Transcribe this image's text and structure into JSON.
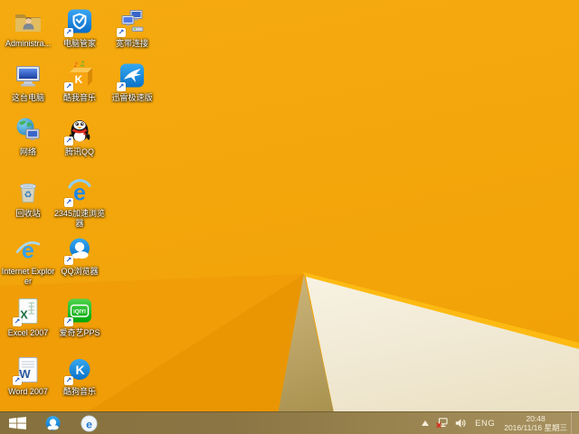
{
  "wallpaper": {
    "base_color": "#f4a70d",
    "facet_medium": "#f09d07",
    "facet_dark": "#ea9603",
    "facet_khaki": "#b89f5e",
    "facet_cream": "#f3edda",
    "edge_highlight": "#fdba12"
  },
  "desktop": {
    "icons": [
      {
        "name": "administrator-folder",
        "label": "Administra..."
      },
      {
        "name": "pc-manager",
        "label": "电脑管家"
      },
      {
        "name": "broadband-connection",
        "label": "宽带连接"
      },
      {
        "name": "this-pc",
        "label": "这台电脑"
      },
      {
        "name": "kuwo-music",
        "label": "酷我音乐"
      },
      {
        "name": "xunlei-speed",
        "label": "迅雷极速版"
      },
      {
        "name": "network",
        "label": "网络"
      },
      {
        "name": "tencent-qq",
        "label": "腾讯QQ"
      },
      {
        "name": "recycle-bin",
        "label": "回收站"
      },
      {
        "name": "browser-2345",
        "label": "2345加速浏览器"
      },
      {
        "name": "internet-explorer",
        "label": "Internet Explorer"
      },
      {
        "name": "qq-browser",
        "label": "QQ浏览器"
      },
      {
        "name": "excel-2007",
        "label": "Excel 2007"
      },
      {
        "name": "iqiyi-pps",
        "label": "爱奇艺PPS"
      },
      {
        "name": "word-2007",
        "label": "Word 2007"
      },
      {
        "name": "kugou-music",
        "label": "酷狗音乐"
      }
    ]
  },
  "taskbar": {
    "tray": {
      "language": "ENG",
      "time": "20:48",
      "date": "2016/11/16 星期三"
    }
  }
}
